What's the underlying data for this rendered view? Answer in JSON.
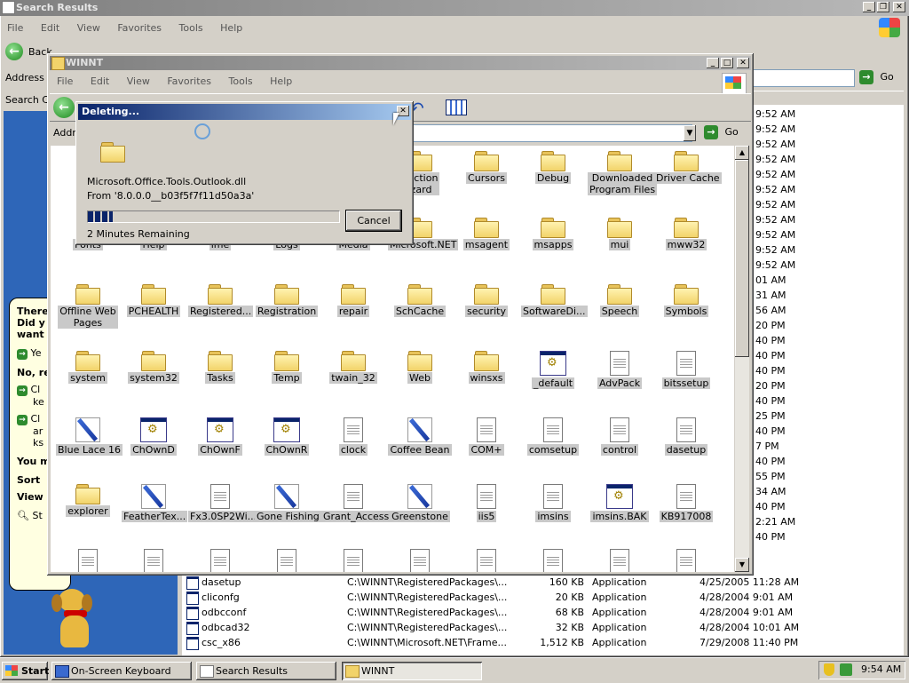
{
  "search_window": {
    "title": "Search Results",
    "menu": [
      "File",
      "Edit",
      "View",
      "Favorites",
      "Tools",
      "Help"
    ],
    "back_label": "Back",
    "address_label": "Address",
    "go_label": "Go",
    "search_label": "Search C",
    "partial_times": [
      "9:52 AM",
      "9:52 AM",
      "9:52 AM",
      "9:52 AM",
      "9:52 AM",
      "9:52 AM",
      "9:52 AM",
      "9:52 AM",
      "9:52 AM",
      "9:52 AM",
      "9:52 AM",
      "01 AM",
      "31 AM",
      "56 AM",
      "20 PM",
      "40 PM",
      "40 PM",
      "40 PM",
      "20 PM",
      "40 PM",
      "25 PM",
      "40 PM",
      "7 PM",
      "40 PM",
      "55 PM",
      "34 AM",
      "40 PM",
      "2:21 AM",
      "40 PM"
    ],
    "results": [
      {
        "name": "dasetup",
        "folder": "C:\\WINNT\\RegisteredPackages\\...",
        "size": "160 KB",
        "type": "Application",
        "modified": "4/25/2005 11:28 AM"
      },
      {
        "name": "cliconfg",
        "folder": "C:\\WINNT\\RegisteredPackages\\...",
        "size": "20 KB",
        "type": "Application",
        "modified": "4/28/2004 9:01 AM"
      },
      {
        "name": "odbcconf",
        "folder": "C:\\WINNT\\RegisteredPackages\\...",
        "size": "68 KB",
        "type": "Application",
        "modified": "4/28/2004 9:01 AM"
      },
      {
        "name": "odbcad32",
        "folder": "C:\\WINNT\\RegisteredPackages\\...",
        "size": "32 KB",
        "type": "Application",
        "modified": "4/28/2004 10:01 AM"
      },
      {
        "name": "csc_x86",
        "folder": "C:\\WINNT\\Microsoft.NET\\Frame...",
        "size": "1,512 KB",
        "type": "Application",
        "modified": "7/29/2008 11:40 PM"
      }
    ]
  },
  "assistant": {
    "lines": [
      "There",
      "Did y",
      "want"
    ],
    "opt1": "Ye",
    "no_label": "No, re",
    "opt2a": "Cl",
    "opt2b": "ke",
    "opt3a": "Cl",
    "opt3b": "ar",
    "opt3c": "ks",
    "you_may": "You m",
    "sort": "Sort",
    "view": "View",
    "st": "St"
  },
  "winnt_window": {
    "title": "WINNT",
    "menu": [
      "File",
      "Edit",
      "View",
      "Favorites",
      "Tools",
      "Help"
    ],
    "address_label": "Addr",
    "go_label": "Go",
    "items": [
      {
        "label": "nection\nizard",
        "icon": "folder"
      },
      {
        "label": "Cursors",
        "icon": "folder"
      },
      {
        "label": "Debug",
        "icon": "folder"
      },
      {
        "label": "Downloaded\nProgram Files",
        "icon": "folder"
      },
      {
        "label": "Driver Cache",
        "icon": "folder"
      },
      {
        "label": "Fonts",
        "icon": "folder"
      },
      {
        "label": "Help",
        "icon": "folder"
      },
      {
        "label": "ime",
        "icon": "folder"
      },
      {
        "label": "Logs",
        "icon": "folder"
      },
      {
        "label": "Media",
        "icon": "folder"
      },
      {
        "label": "Microsoft.NET",
        "icon": "folder"
      },
      {
        "label": "msagent",
        "icon": "folder"
      },
      {
        "label": "msapps",
        "icon": "folder"
      },
      {
        "label": "mui",
        "icon": "folder"
      },
      {
        "label": "mww32",
        "icon": "folder"
      },
      {
        "label": "Offline Web\nPages",
        "icon": "folder"
      },
      {
        "label": "PCHEALTH",
        "icon": "folder"
      },
      {
        "label": "Registered...",
        "icon": "folder"
      },
      {
        "label": "Registration",
        "icon": "folder"
      },
      {
        "label": "repair",
        "icon": "folder"
      },
      {
        "label": "SchCache",
        "icon": "folder"
      },
      {
        "label": "security",
        "icon": "folder"
      },
      {
        "label": "SoftwareDi...",
        "icon": "folder"
      },
      {
        "label": "Speech",
        "icon": "folder"
      },
      {
        "label": "Symbols",
        "icon": "folder"
      },
      {
        "label": "system",
        "icon": "folder"
      },
      {
        "label": "system32",
        "icon": "folder"
      },
      {
        "label": "Tasks",
        "icon": "folder"
      },
      {
        "label": "Temp",
        "icon": "folder"
      },
      {
        "label": "twain_32",
        "icon": "folder"
      },
      {
        "label": "Web",
        "icon": "folder"
      },
      {
        "label": "winsxs",
        "icon": "folder"
      },
      {
        "label": "_default",
        "icon": "app"
      },
      {
        "label": "AdvPack",
        "icon": "doc"
      },
      {
        "label": "bitssetup",
        "icon": "doc"
      },
      {
        "label": "Blue Lace 16",
        "icon": "pen"
      },
      {
        "label": "ChOwnD",
        "icon": "app"
      },
      {
        "label": "ChOwnF",
        "icon": "app"
      },
      {
        "label": "ChOwnR",
        "icon": "app"
      },
      {
        "label": "clock",
        "icon": "doc"
      },
      {
        "label": "Coffee Bean",
        "icon": "pen"
      },
      {
        "label": "COM+",
        "icon": "doc"
      },
      {
        "label": "comsetup",
        "icon": "doc"
      },
      {
        "label": "control",
        "icon": "doc"
      },
      {
        "label": "dasetup",
        "icon": "doc"
      },
      {
        "label": "explorer",
        "icon": "folder"
      },
      {
        "label": "FeatherTex...",
        "icon": "pen"
      },
      {
        "label": "Fx3.0SP2Wi...",
        "icon": "doc"
      },
      {
        "label": "Gone Fishing",
        "icon": "pen"
      },
      {
        "label": "Grant_Access",
        "icon": "doc"
      },
      {
        "label": "Greenstone",
        "icon": "pen"
      },
      {
        "label": "iis5",
        "icon": "doc"
      },
      {
        "label": "imsins",
        "icon": "doc"
      },
      {
        "label": "imsins.BAK",
        "icon": "app"
      },
      {
        "label": "KB917008",
        "icon": "doc"
      }
    ]
  },
  "delete_dialog": {
    "title": "Deleting...",
    "filename": "Microsoft.Office.Tools.Outlook.dll",
    "from": "From '8.0.0.0__b03f5f7f11d50a3a'",
    "progress": 0.1,
    "remaining": "2 Minutes Remaining",
    "cancel_label": "Cancel"
  },
  "taskbar": {
    "start_label": "Start",
    "tasks": [
      {
        "label": "On-Screen Keyboard"
      },
      {
        "label": "Search Results"
      },
      {
        "label": "WINNT"
      }
    ],
    "clock": "9:54 AM"
  }
}
